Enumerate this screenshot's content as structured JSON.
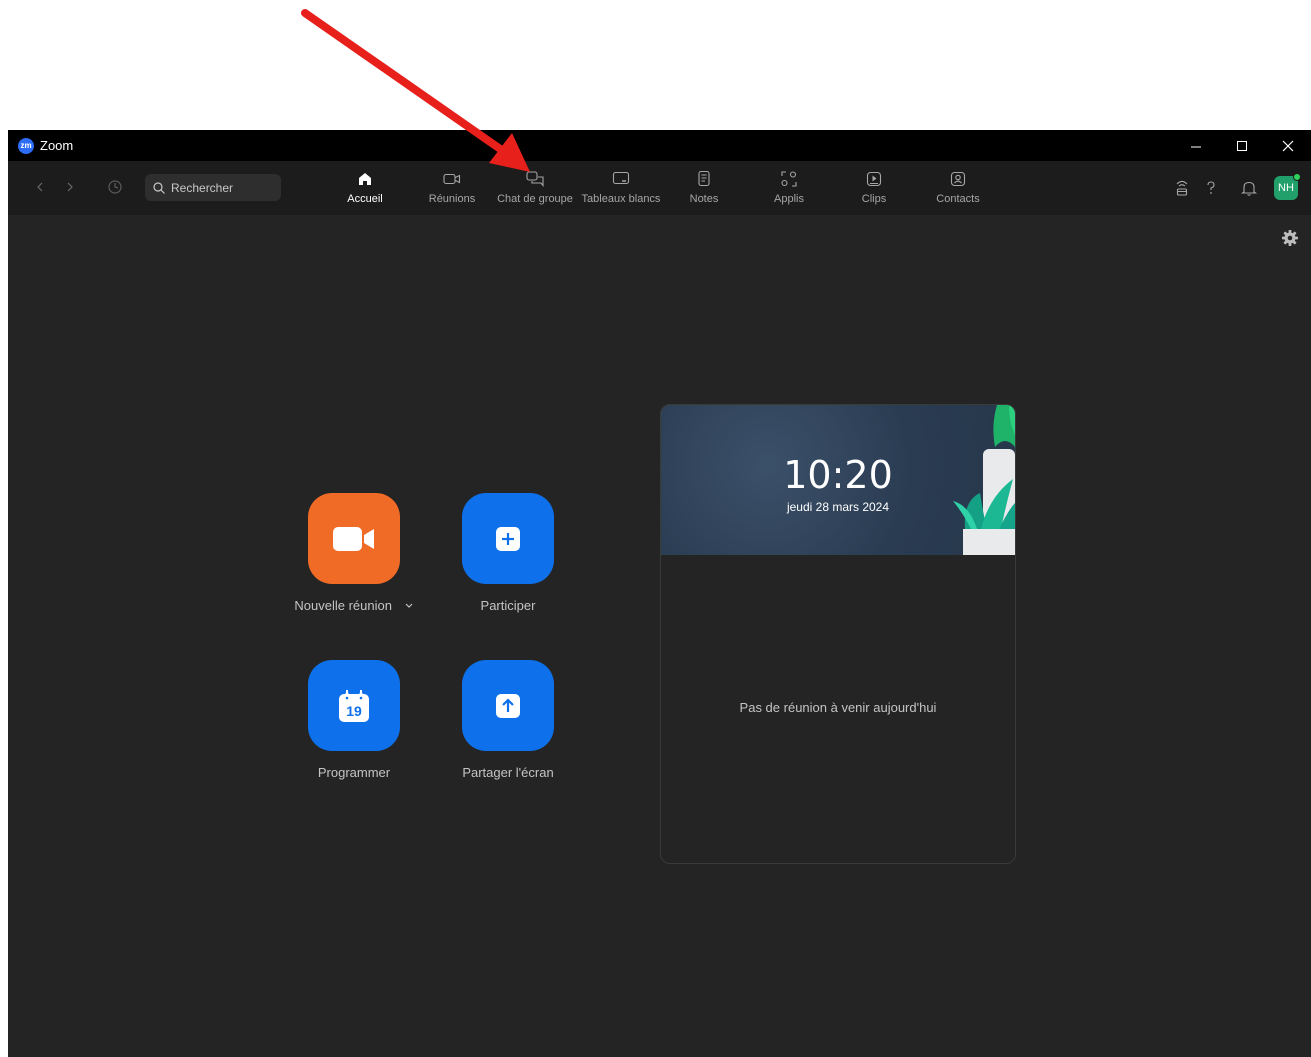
{
  "window": {
    "title": "Zoom",
    "logo_text": "zm"
  },
  "search": {
    "placeholder": "Rechercher"
  },
  "tabs": [
    {
      "label": "Accueil",
      "icon": "home-icon",
      "active": true
    },
    {
      "label": "Réunions",
      "icon": "video-camera-icon",
      "active": false
    },
    {
      "label": "Chat de groupe",
      "icon": "chat-bubbles-icon",
      "active": false
    },
    {
      "label": "Tableaux blancs",
      "icon": "whiteboard-icon",
      "active": false
    },
    {
      "label": "Notes",
      "icon": "notes-icon",
      "active": false
    },
    {
      "label": "Applis",
      "icon": "apps-icon",
      "active": false
    },
    {
      "label": "Clips",
      "icon": "clips-icon",
      "active": false
    },
    {
      "label": "Contacts",
      "icon": "contacts-icon",
      "active": false
    }
  ],
  "header_right": {
    "avatar_initials": "NH",
    "icons": [
      "wifi-broadcast-icon",
      "help-icon",
      "bell-icon"
    ]
  },
  "actions": {
    "new_meeting": "Nouvelle réunion",
    "join": "Participer",
    "schedule": "Programmer",
    "schedule_day": "19",
    "share_screen": "Partager l'écran"
  },
  "calendar_card": {
    "time": "10:20",
    "date": "jeudi 28 mars 2024",
    "empty_message": "Pas de réunion à venir aujourd'hui"
  },
  "colors": {
    "accent_blue": "#0e71eb",
    "new_meeting_orange": "#f06b26",
    "annotation_arrow": "#e8201c",
    "presence_green": "#2fd35b"
  }
}
